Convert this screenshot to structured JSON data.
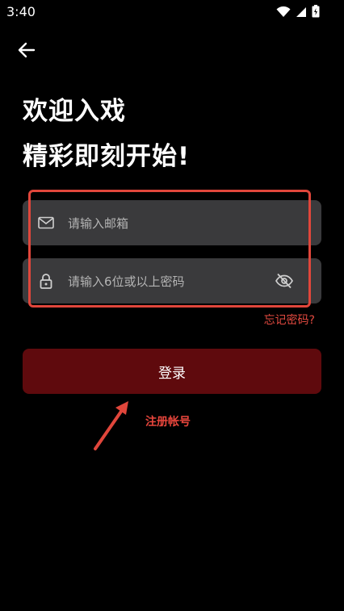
{
  "status_bar": {
    "time": "3:40"
  },
  "header": {
    "back_icon": "arrow-left-icon",
    "title_line1": "欢迎入戏",
    "title_line2": "精彩即刻开始!"
  },
  "form": {
    "email": {
      "placeholder": "请输入邮箱",
      "value": "",
      "icon": "mail-icon"
    },
    "password": {
      "placeholder": "请输入6位或以上密码",
      "value": "",
      "icon": "lock-icon",
      "toggle_icon": "eye-off-icon"
    },
    "forgot_label": "忘记密码?",
    "login_label": "登录",
    "register_label": "注册帐号"
  },
  "colors": {
    "background": "#000000",
    "field_bg": "#3a3a3c",
    "login_button": "#5f0a0d",
    "annotation_red": "#e0463b"
  }
}
